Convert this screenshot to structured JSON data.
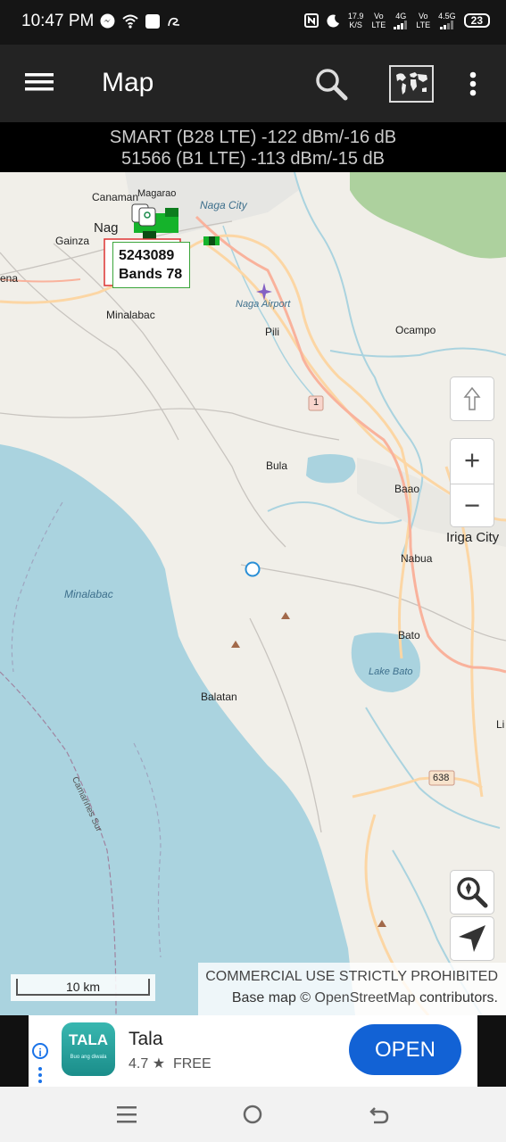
{
  "status_bar": {
    "time": "10:47 PM",
    "net_speed_value": "17.9",
    "net_speed_unit": "K/S",
    "sim1_label_top": "Vo",
    "sim1_label_bottom": "LTE",
    "sim1_type": "4G",
    "sim2_label_top": "Vo",
    "sim2_label_bottom": "LTE",
    "sim2_type": "4.5G",
    "battery": "23"
  },
  "app_bar": {
    "title": "Map",
    "icons": [
      "menu-icon",
      "search-icon",
      "world-map-icon",
      "more-vert-icon"
    ]
  },
  "signal_info": {
    "line1": "SMART (B28 LTE) -122 dBm/-16 dB",
    "line2": "51566 (B1 LTE) -113 dBm/-15 dB"
  },
  "map": {
    "labels": {
      "magarao": "Magarao",
      "canaman": "Canaman",
      "naga_city": "Naga City",
      "naga": "Nag",
      "gainza": "Gainza",
      "milaor": "ena",
      "minalabac": "Minalabac",
      "naga_airport": "Naga Airport",
      "pili": "Pili",
      "ocampo": "Ocampo",
      "bula": "Bula",
      "baao": "Baao",
      "iriga": "Iriga City",
      "nabua": "Nabua",
      "minalabac_bay": "Minalabac",
      "bato": "Bato",
      "lake_bato": "Lake Bato",
      "balatan": "Balatan",
      "camarines_sur": "Camarines Sur",
      "route_1": "1",
      "route_638": "638",
      "edge_li": "Li"
    },
    "cell_popup": {
      "id": "5243089",
      "bands": "Bands 78"
    },
    "colors": {
      "land": "#f1efe9",
      "water": "#aad3df",
      "forest": "#add19e",
      "primary_road": "#fcd6a4",
      "trunk_road": "#f9b29c",
      "popup_green": "#3aa53a",
      "popup_red": "#d33",
      "cell_green": "#15b32b",
      "location_marker": "#2a8fd6"
    },
    "zoom_in_label": "+",
    "zoom_out_label": "−",
    "scale_text": "10 km",
    "attribution_line1": "COMMERCIAL USE STRICTLY PROHIBITED",
    "attribution_prefix": "Base map ©",
    "attribution_link": "OpenStreetMap",
    "attribution_suffix": "contributors.",
    "controls": [
      "compass-north-icon",
      "zoom-search-icon",
      "my-location-icon"
    ]
  },
  "ad": {
    "app_name": "Tala",
    "logo_text": "TALA",
    "logo_tagline": "Buo ang diwala",
    "rating": "4.7",
    "star": "★",
    "price": "FREE",
    "cta": "OPEN",
    "info_icon": "i"
  },
  "nav_bar": {
    "buttons": [
      "recents-icon",
      "home-icon",
      "back-icon"
    ]
  }
}
